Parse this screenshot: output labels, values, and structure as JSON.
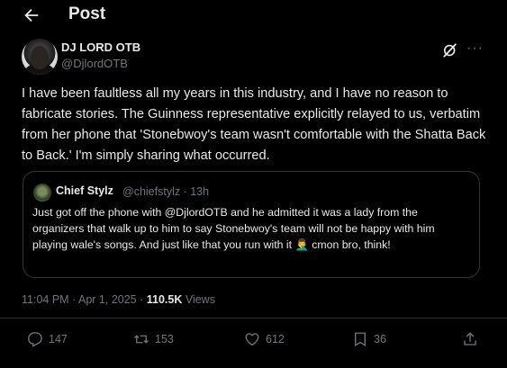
{
  "header": {
    "title": "Post"
  },
  "author": {
    "name": "DJ LORD OTB",
    "handle": "@DjlordOTB"
  },
  "post": {
    "text": "I have been faultless all my years in this industry, and I have no reason to fabricate stories. The Guinness representative explicitly relayed to us, verbatim from her phone that 'Stonebwoy's team wasn't comfortable with the Shatta Back to Back.' I'm simply sharing what occurred."
  },
  "quote": {
    "name": "Chief Stylz",
    "meta": "@chiefstylz · 13h",
    "text_before": "Just got off the phone with ",
    "mention": "@DjlordOTB",
    "text_after": "  and he admitted it was a lady from the organizers that walk up to him to say Stonebwoy's team will not be happy with him playing wale's songs. And just like that you run with it 🤦‍♂️ cmon bro, think!"
  },
  "meta": {
    "time": "11:04 PM · Apr 1, 2025 · ",
    "views_count": "110.5K",
    "views_label": " Views"
  },
  "actions": {
    "replies": "147",
    "reposts": "153",
    "likes": "612",
    "bookmarks": "36"
  },
  "colors": {
    "background": "#000000",
    "text": "#e7e9ea",
    "muted": "#71767b",
    "border": "#333639"
  },
  "icons": [
    "back-arrow-icon",
    "grok-icon",
    "more-icon",
    "reply-icon",
    "retweet-icon",
    "like-icon",
    "bookmark-icon",
    "share-icon"
  ]
}
